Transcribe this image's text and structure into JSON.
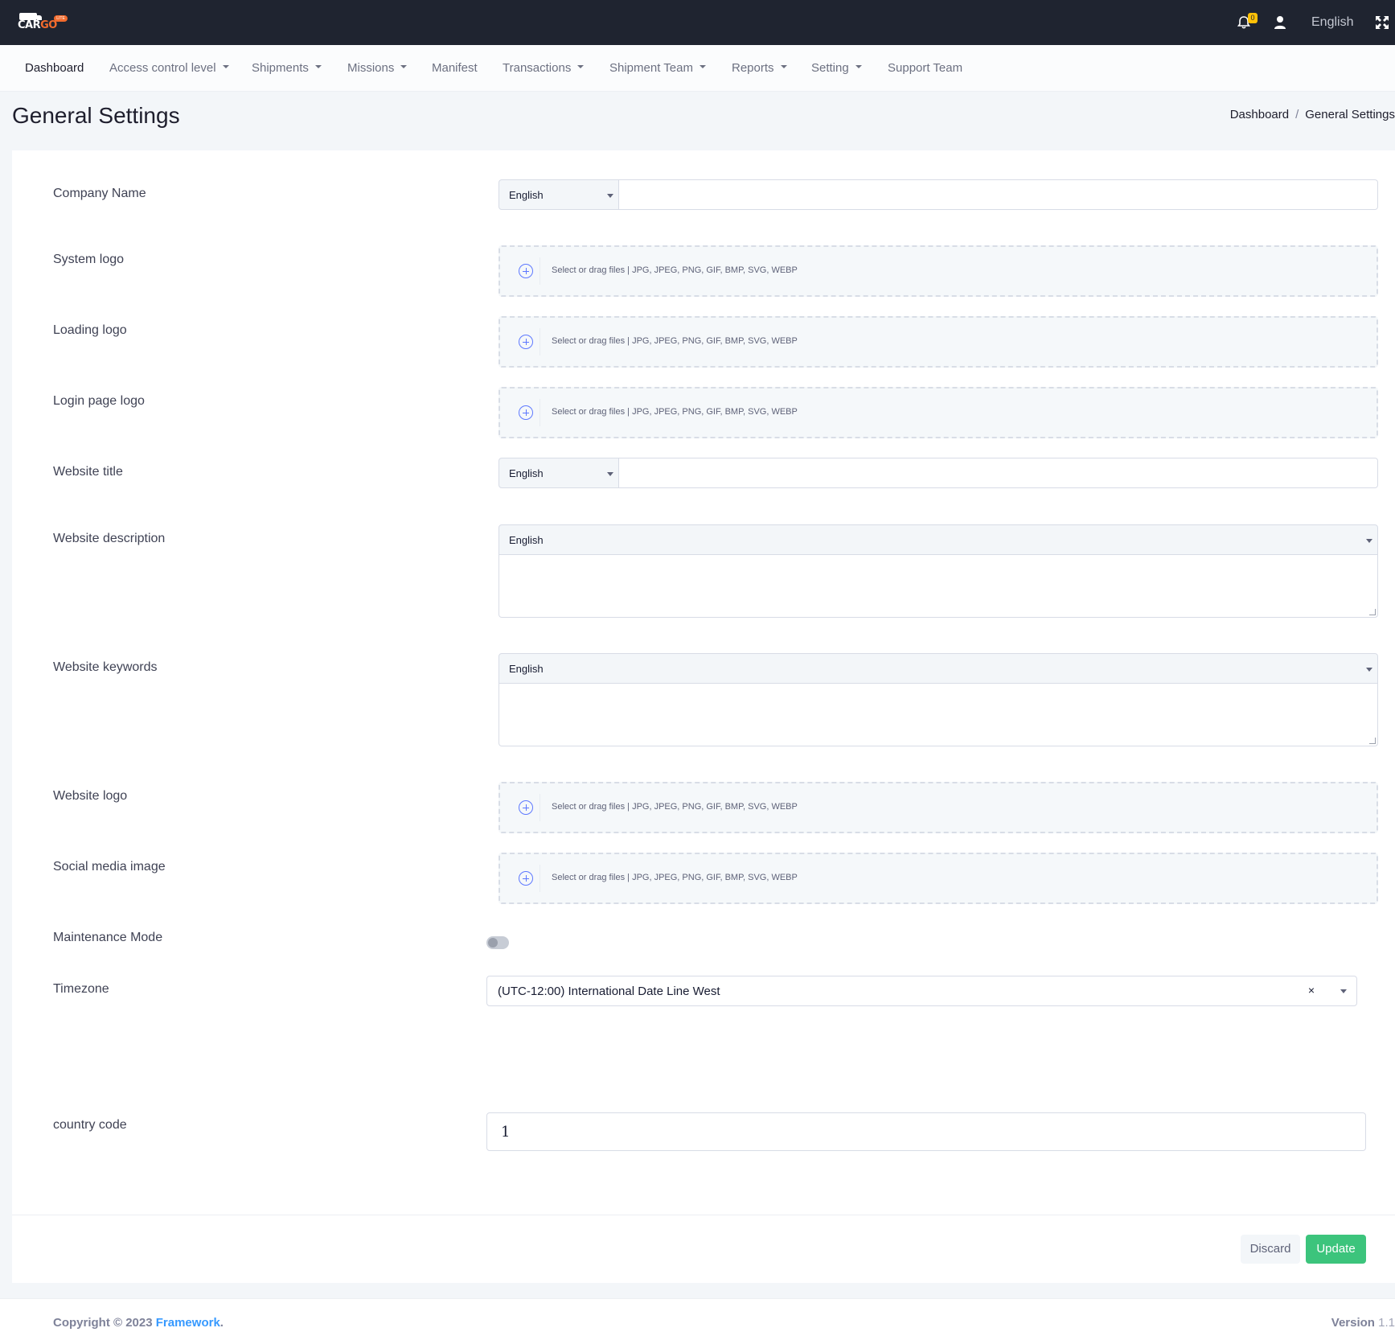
{
  "header": {
    "logo_text_car": "CAR",
    "logo_text_go": "GO",
    "logo_badge": "LITE",
    "notification_count": "0",
    "language": "English"
  },
  "nav": {
    "items": [
      {
        "label": "Dashboard",
        "dropdown": false
      },
      {
        "label": "Access control level",
        "dropdown": true
      },
      {
        "label": "Shipments",
        "dropdown": true
      },
      {
        "label": "Missions",
        "dropdown": true
      },
      {
        "label": "Manifest",
        "dropdown": false
      },
      {
        "label": "Transactions",
        "dropdown": true
      },
      {
        "label": "Shipment Team",
        "dropdown": true
      },
      {
        "label": "Reports",
        "dropdown": true
      },
      {
        "label": "Setting",
        "dropdown": true
      },
      {
        "label": "Support Team",
        "dropdown": false
      }
    ]
  },
  "page": {
    "title": "General Settings",
    "breadcrumb": [
      "Dashboard",
      "General Settings"
    ]
  },
  "form": {
    "upload_hint": "Select or drag files | JPG, JPEG, PNG, GIF, BMP, SVG, WEBP",
    "company_name": {
      "label": "Company Name",
      "language": "English",
      "value": ""
    },
    "system_logo": {
      "label": "System logo"
    },
    "loading_logo": {
      "label": "Loading logo"
    },
    "login_page_logo": {
      "label": "Login page logo"
    },
    "website_title": {
      "label": "Website title",
      "language": "English",
      "value": ""
    },
    "website_description": {
      "label": "Website description",
      "language": "English",
      "value": ""
    },
    "website_keywords": {
      "label": "Website keywords",
      "language": "English",
      "value": ""
    },
    "website_logo": {
      "label": "Website logo"
    },
    "social_media_image": {
      "label": "Social media image"
    },
    "maintenance_mode": {
      "label": "Maintenance Mode",
      "enabled": false
    },
    "timezone": {
      "label": "Timezone",
      "value": "(UTC-12:00) International Date Line West",
      "clear": "×"
    },
    "country_code": {
      "label": "country code",
      "value": "1"
    }
  },
  "actions": {
    "discard": "Discard",
    "update": "Update"
  },
  "footer": {
    "copyright_prefix": "Copyright © 2023 ",
    "brand": "Framework",
    "brand_suffix": ".",
    "version_label": "Version",
    "version_number": "1.1"
  },
  "colors": {
    "topbar": "#1f2430",
    "accent": "#3699ff",
    "success": "#3cc47c",
    "brand_orange": "#f26b2d",
    "badge_yellow": "#ffc107"
  }
}
